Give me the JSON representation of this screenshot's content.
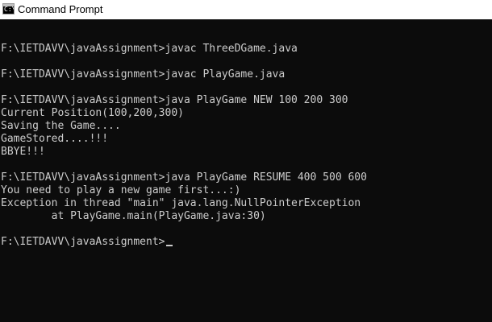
{
  "window": {
    "title": "Command Prompt",
    "icon": "command-prompt-icon",
    "icon_glyph": "C:\\"
  },
  "console": {
    "background": "#0c0c0c",
    "foreground": "#cccccc",
    "lines": [
      "",
      "F:\\IETDAVV\\javaAssignment>javac ThreeDGame.java",
      "",
      "F:\\IETDAVV\\javaAssignment>javac PlayGame.java",
      "",
      "F:\\IETDAVV\\javaAssignment>java PlayGame NEW 100 200 300",
      "Current Position(100,200,300)",
      "Saving the Game....",
      "GameStored....!!!",
      "BBYE!!!",
      "",
      "F:\\IETDAVV\\javaAssignment>java PlayGame RESUME 400 500 600",
      "You need to play a new game first...:)",
      "Exception in thread \"main\" java.lang.NullPointerException",
      "        at PlayGame.main(PlayGame.java:30)",
      "",
      "F:\\IETDAVV\\javaAssignment>"
    ]
  }
}
